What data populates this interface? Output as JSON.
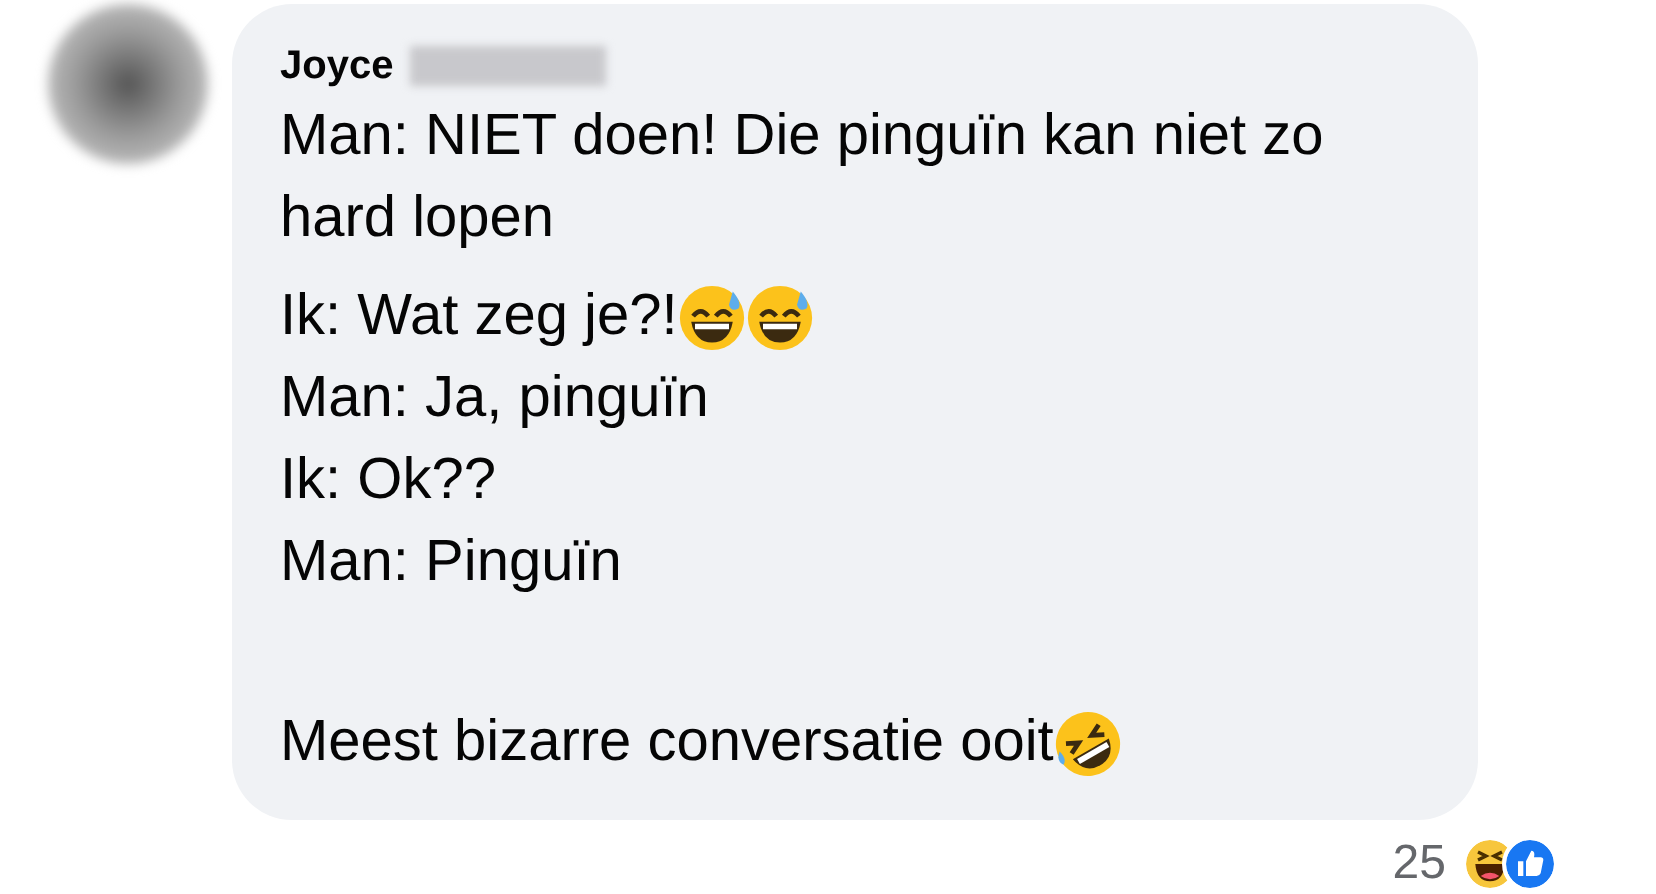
{
  "comment": {
    "author": "Joyce",
    "paragraphs": [
      {
        "lines": [
          {
            "text": "Man: NIET doen! Die pinguïn kan niet zo hard lopen"
          }
        ]
      },
      {
        "lines": [
          {
            "text": "Ik: Wat zeg je?! ",
            "emojis": [
              {
                "kind": "grin-sweat"
              },
              {
                "kind": "grin-sweat"
              }
            ]
          },
          {
            "text": "Man: Ja, pinguïn"
          },
          {
            "text": "Ik: Ok??"
          },
          {
            "text": "Man: Pinguïn"
          }
        ]
      },
      {
        "blank_line_before": true,
        "lines": [
          {
            "text": "Meest bizarre conversatie ooit",
            "emojis": [
              {
                "kind": "rofl"
              }
            ]
          }
        ]
      }
    ],
    "reactions": {
      "count": "25",
      "icons": [
        {
          "kind": "haha"
        },
        {
          "kind": "like"
        }
      ]
    }
  }
}
